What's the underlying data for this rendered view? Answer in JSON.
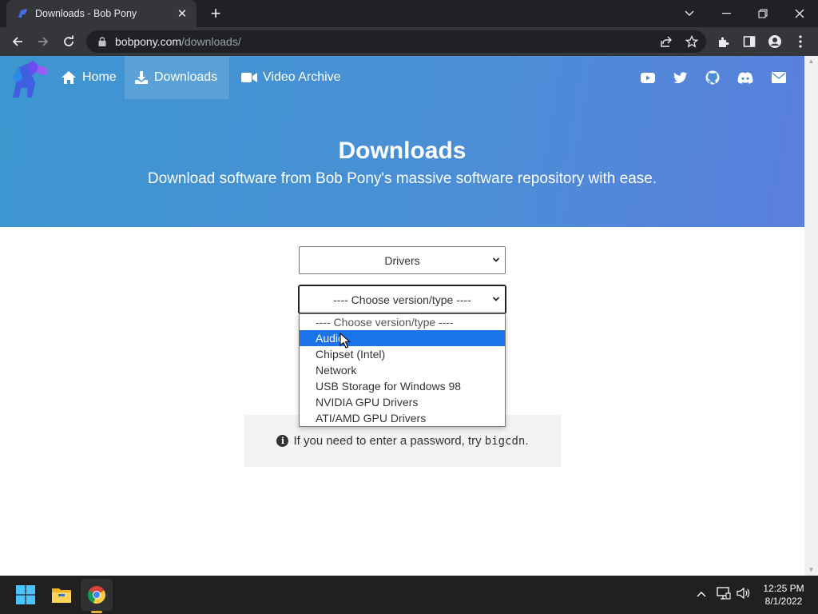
{
  "browser": {
    "tab_title": "Downloads - Bob Pony",
    "url_domain": "bobpony.com",
    "url_path": "/downloads/"
  },
  "site": {
    "nav": [
      {
        "label": "Home",
        "icon": "home-icon"
      },
      {
        "label": "Downloads",
        "icon": "download-icon",
        "active": true
      },
      {
        "label": "Video Archive",
        "icon": "video-icon"
      }
    ],
    "social_icons": [
      "youtube-icon",
      "twitter-icon",
      "github-icon",
      "discord-icon",
      "mail-icon"
    ],
    "hero_title": "Downloads",
    "hero_subtitle": "Download software from Bob Pony's massive software repository with ease.",
    "brand_colors": {
      "hero_start": "#3d96cf",
      "hero_end": "#5a7fdc",
      "selection": "#1a73e8"
    }
  },
  "form": {
    "category_select": {
      "value": "Drivers"
    },
    "version_select": {
      "value": "---- Choose version/type ----",
      "options": [
        "---- Choose version/type ----",
        "Audio",
        "Chipset (Intel)",
        "Network",
        "USB Storage for Windows 98",
        "NVIDIA GPU Drivers",
        "ATI/AMD GPU Drivers"
      ],
      "highlighted": "Audio"
    }
  },
  "info": {
    "text": "If you need to enter a password, try ",
    "code": "bigcdn",
    "end": "."
  },
  "taskbar": {
    "time": "12:25 PM",
    "date": "8/1/2022"
  }
}
